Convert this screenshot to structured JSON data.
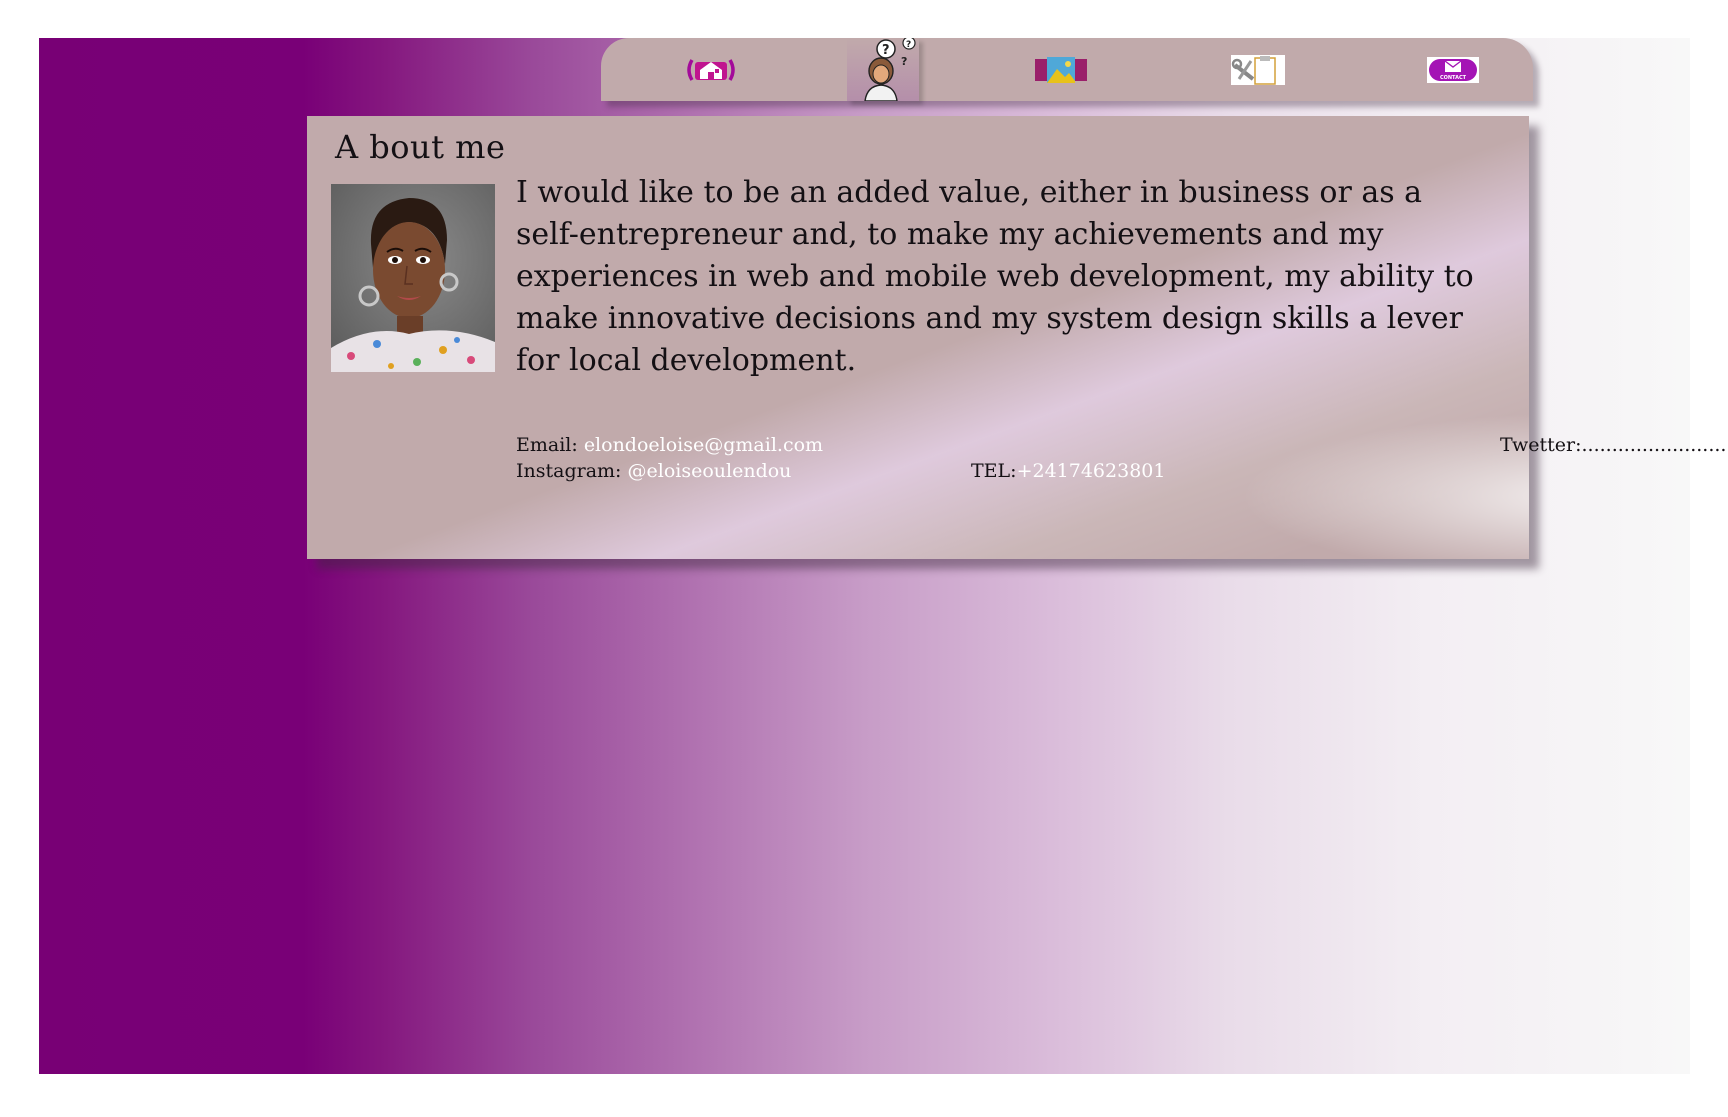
{
  "nav": {
    "items": [
      {
        "name": "home",
        "icon": "home-icon"
      },
      {
        "name": "about",
        "icon": "person-question-icon",
        "active": true
      },
      {
        "name": "gallery",
        "icon": "gallery-image-icon"
      },
      {
        "name": "skills",
        "icon": "clipboard-tools-icon"
      },
      {
        "name": "contact",
        "icon": "envelope-icon",
        "icon_label": "CONTACT"
      }
    ]
  },
  "about": {
    "title": "A bout me",
    "text": "I would like to be an added value, either in business or as a self-entrepreneur and, to make my achievements and my experiences in web and mobile web development, my ability to make innovative decisions and my system design skills a lever for local development.",
    "email_label": "Email: ",
    "email_value": "elondoeloise@gmail.com",
    "twitter_label": "Twetter:",
    "twitter_value": "..................................",
    "instagram_label": "Instagram: ",
    "instagram_value": "@eloiseoulendou",
    "tel_label": "TEL:",
    "tel_value": "+24174623801"
  },
  "colors": {
    "brand_purple": "#780075",
    "panel": "#c1aaab"
  }
}
